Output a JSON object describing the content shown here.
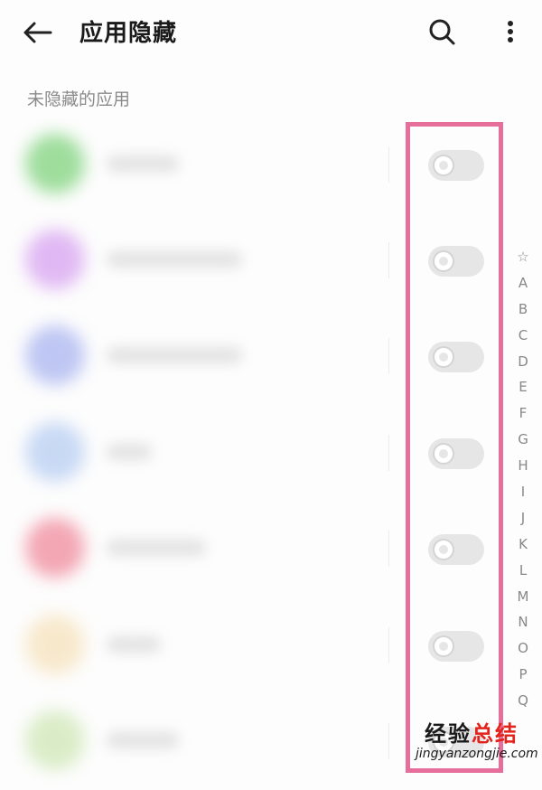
{
  "header": {
    "title": "应用隐藏"
  },
  "section_title": "未隐藏的应用",
  "apps": [
    {
      "icon_color": "#7fd37c",
      "toggle_on": false
    },
    {
      "icon_color": "#d7a2f0",
      "toggle_on": false
    },
    {
      "icon_color": "#a9b4f0",
      "toggle_on": false
    },
    {
      "icon_color": "#b7cdf2",
      "toggle_on": false
    },
    {
      "icon_color": "#f08a9c",
      "toggle_on": false
    },
    {
      "icon_color": "#f6e2bc",
      "toggle_on": false
    },
    {
      "icon_color": "#cfe7b6",
      "toggle_on": false
    }
  ],
  "alphabet_index": [
    "☆",
    "A",
    "B",
    "C",
    "D",
    "E",
    "F",
    "G",
    "H",
    "I",
    "J",
    "K",
    "L",
    "M",
    "N",
    "O",
    "P",
    "Q"
  ],
  "watermark": {
    "logo_main": "经验",
    "logo_accent": "总结",
    "url": "jingyanzongjie.com"
  },
  "colors": {
    "highlight": "#e56f9a",
    "toggle_off": "#e6e6e6"
  }
}
